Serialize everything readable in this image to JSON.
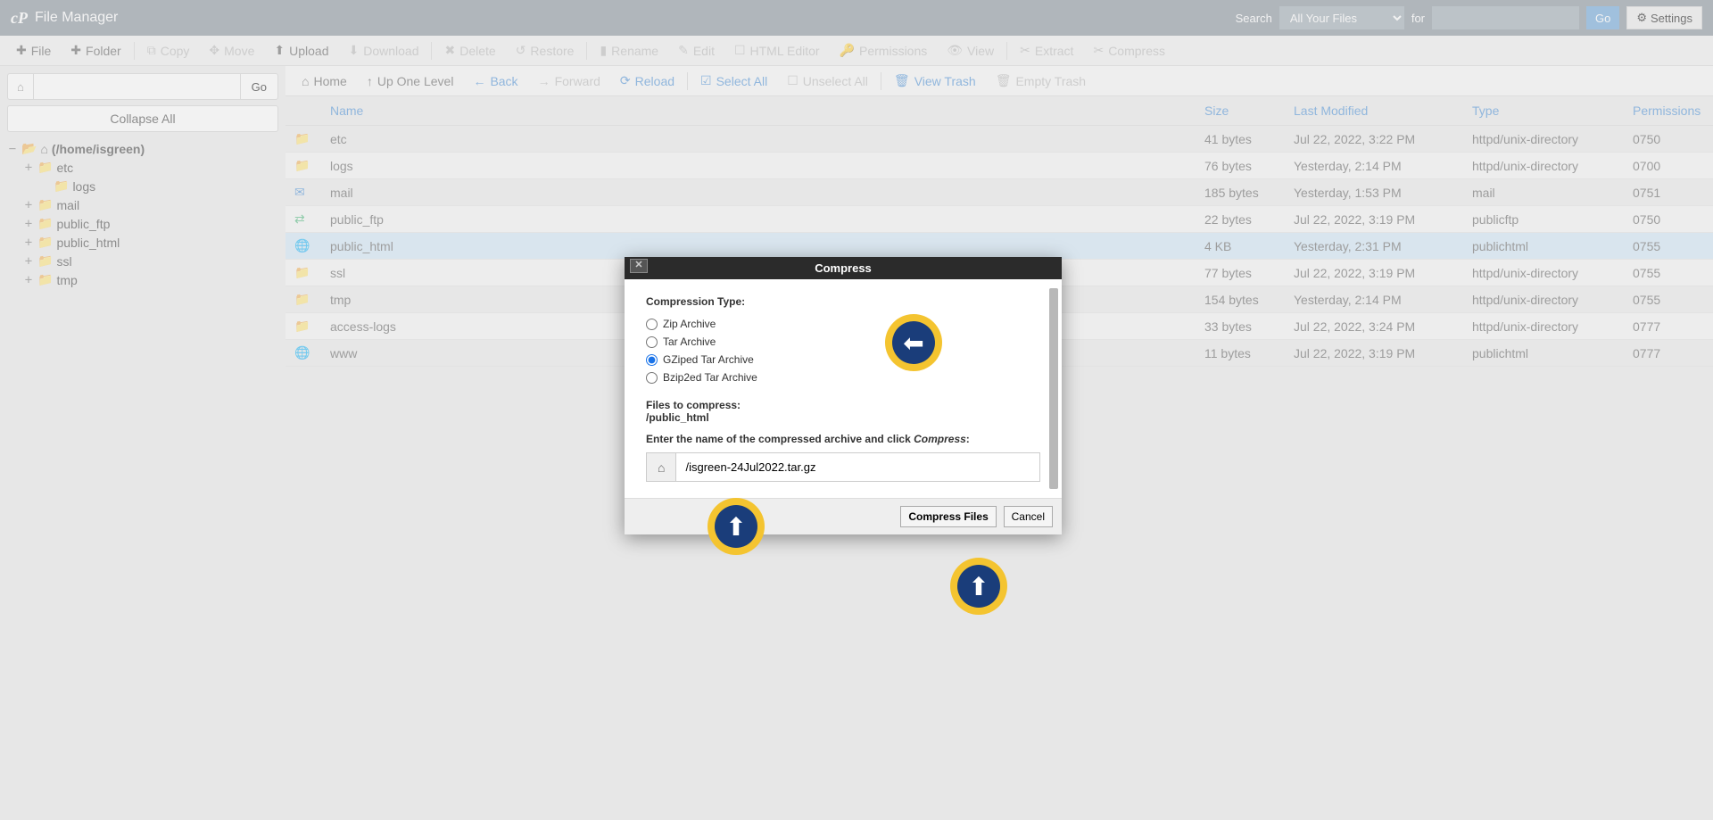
{
  "header": {
    "title": "File Manager",
    "search_label": "Search",
    "search_select": "All Your Files",
    "for_label": "for",
    "go": "Go",
    "settings": "Settings"
  },
  "toolbar": {
    "file": "File",
    "folder": "Folder",
    "copy": "Copy",
    "move": "Move",
    "upload": "Upload",
    "download": "Download",
    "delete": "Delete",
    "restore": "Restore",
    "rename": "Rename",
    "edit": "Edit",
    "html_editor": "HTML Editor",
    "permissions": "Permissions",
    "view": "View",
    "extract": "Extract",
    "compress": "Compress"
  },
  "sidebar": {
    "go": "Go",
    "collapse": "Collapse All",
    "root": "(/home/isgreen)",
    "tree": [
      "etc",
      "logs",
      "mail",
      "public_ftp",
      "public_html",
      "ssl",
      "tmp"
    ]
  },
  "nav": {
    "home": "Home",
    "up": "Up One Level",
    "back": "Back",
    "forward": "Forward",
    "reload": "Reload",
    "select_all": "Select All",
    "unselect_all": "Unselect All",
    "view_trash": "View Trash",
    "empty_trash": "Empty Trash"
  },
  "columns": {
    "name": "Name",
    "size": "Size",
    "modified": "Last Modified",
    "type": "Type",
    "perm": "Permissions"
  },
  "files": [
    {
      "icon": "folder",
      "name": "etc",
      "size": "41 bytes",
      "modified": "Jul 22, 2022, 3:22 PM",
      "type": "httpd/unix-directory",
      "perm": "0750"
    },
    {
      "icon": "folder",
      "name": "logs",
      "size": "76 bytes",
      "modified": "Yesterday, 2:14 PM",
      "type": "httpd/unix-directory",
      "perm": "0700"
    },
    {
      "icon": "mail",
      "name": "mail",
      "size": "185 bytes",
      "modified": "Yesterday, 1:53 PM",
      "type": "mail",
      "perm": "0751"
    },
    {
      "icon": "ftp",
      "name": "public_ftp",
      "size": "22 bytes",
      "modified": "Jul 22, 2022, 3:19 PM",
      "type": "publicftp",
      "perm": "0750"
    },
    {
      "icon": "web",
      "name": "public_html",
      "size": "4 KB",
      "modified": "Yesterday, 2:31 PM",
      "type": "publichtml",
      "perm": "0755",
      "selected": true
    },
    {
      "icon": "folder",
      "name": "ssl",
      "size": "77 bytes",
      "modified": "Jul 22, 2022, 3:19 PM",
      "type": "httpd/unix-directory",
      "perm": "0755"
    },
    {
      "icon": "folder",
      "name": "tmp",
      "size": "154 bytes",
      "modified": "Yesterday, 2:14 PM",
      "type": "httpd/unix-directory",
      "perm": "0755"
    },
    {
      "icon": "link",
      "name": "access-logs",
      "size": "33 bytes",
      "modified": "Jul 22, 2022, 3:24 PM",
      "type": "httpd/unix-directory",
      "perm": "0777"
    },
    {
      "icon": "weblink",
      "name": "www",
      "size": "11 bytes",
      "modified": "Jul 22, 2022, 3:19 PM",
      "type": "publichtml",
      "perm": "0777"
    }
  ],
  "modal": {
    "title": "Compress",
    "comp_type": "Compression Type:",
    "opts": {
      "zip": "Zip Archive",
      "tar": "Tar Archive",
      "gz": "GZiped Tar Archive",
      "bz": "Bzip2ed Tar Archive"
    },
    "files_label": "Files to compress:",
    "files_value": "/public_html",
    "enter_name_pre": "Enter the name of the compressed archive and click ",
    "enter_name_em": "Compress",
    "archive_name": "/isgreen-24Jul2022.tar.gz",
    "compress_btn": "Compress Files",
    "cancel_btn": "Cancel"
  }
}
